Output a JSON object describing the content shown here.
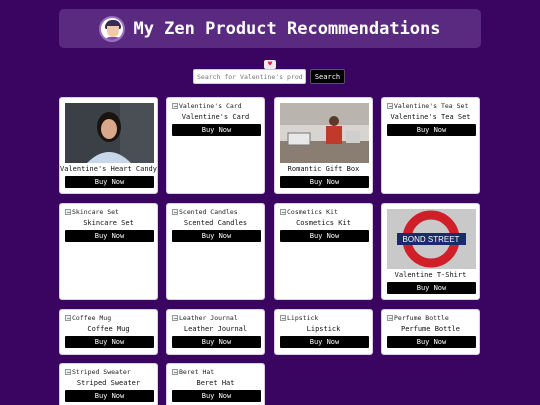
{
  "header": {
    "title": "My Zen Product Recommendations",
    "avatar_icon": "avatar-icon"
  },
  "search": {
    "placeholder": "Search for Valentine's product",
    "button_label": "Search",
    "heart": "♥"
  },
  "products": [
    {
      "name": "Valentine's Heart Candy",
      "alt": "",
      "buy": "Buy Now",
      "image": "portrait-woman"
    },
    {
      "name": "Valentine's Card",
      "alt": "Valentine's Card",
      "buy": "Buy Now",
      "image": "broken"
    },
    {
      "name": "Romantic Gift Box",
      "alt": "",
      "buy": "Buy Now",
      "image": "shop-counter"
    },
    {
      "name": "Valentine's Tea Set",
      "alt": "Valentine's Tea Set",
      "buy": "Buy Now",
      "image": "broken"
    },
    {
      "name": "Skincare Set",
      "alt": "Skincare Set",
      "buy": "Buy Now",
      "image": "broken"
    },
    {
      "name": "Scented Candles",
      "alt": "Scented Candles",
      "buy": "Buy Now",
      "image": "broken"
    },
    {
      "name": "Cosmetics Kit",
      "alt": "Cosmetics Kit",
      "buy": "Buy Now",
      "image": "broken"
    },
    {
      "name": "Valentine T-Shirt",
      "alt": "",
      "buy": "Buy Now",
      "image": "bond-street-sign",
      "sign_text": "BOND STREET"
    },
    {
      "name": "Coffee Mug",
      "alt": "Coffee Mug",
      "buy": "Buy Now",
      "image": "broken"
    },
    {
      "name": "Leather Journal",
      "alt": "Leather Journal",
      "buy": "Buy Now",
      "image": "broken"
    },
    {
      "name": "Lipstick",
      "alt": "Lipstick",
      "buy": "Buy Now",
      "image": "broken"
    },
    {
      "name": "Perfume Bottle",
      "alt": "Perfume Bottle",
      "buy": "Buy Now",
      "image": "broken"
    },
    {
      "name": "Striped Sweater",
      "alt": "Striped Sweater",
      "buy": "Buy Now",
      "image": "broken"
    },
    {
      "name": "Beret Hat",
      "alt": "Beret Hat",
      "buy": "Buy Now",
      "image": "broken"
    }
  ]
}
